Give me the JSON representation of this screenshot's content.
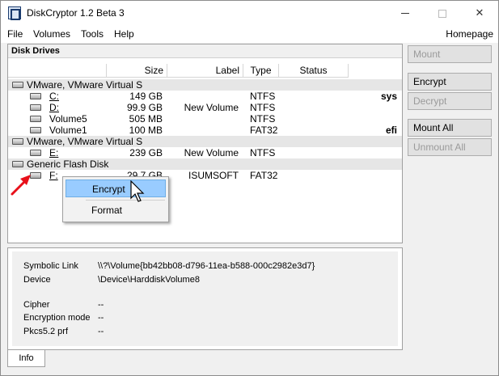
{
  "window": {
    "title": "DiskCryptor 1.2 Beta 3"
  },
  "menu": {
    "file": "File",
    "volumes": "Volumes",
    "tools": "Tools",
    "help": "Help",
    "homepage": "Homepage"
  },
  "drives": {
    "title": "Disk Drives",
    "columns": {
      "size": "Size",
      "label": "Label",
      "type": "Type",
      "status": "Status"
    },
    "groups": [
      {
        "name": "VMware, VMware Virtual S",
        "volumes": [
          {
            "name": "C:",
            "size": "149 GB",
            "label": "",
            "type": "NTFS",
            "flag": "sys"
          },
          {
            "name": "D:",
            "size": "99.9 GB",
            "label": "New Volume",
            "type": "NTFS",
            "flag": ""
          },
          {
            "name": "Volume5",
            "size": "505 MB",
            "label": "",
            "type": "NTFS",
            "flag": ""
          },
          {
            "name": "Volume1",
            "size": "100 MB",
            "label": "",
            "type": "FAT32",
            "flag": "efi"
          }
        ]
      },
      {
        "name": "VMware, VMware Virtual S",
        "volumes": [
          {
            "name": "E:",
            "size": "239 GB",
            "label": "New Volume",
            "type": "NTFS",
            "flag": ""
          }
        ]
      },
      {
        "name": "Generic Flash Disk",
        "volumes": [
          {
            "name": "F:",
            "size": "29.7 GB",
            "label": "ISUMSOFT",
            "type": "FAT32",
            "flag": ""
          }
        ]
      }
    ]
  },
  "context_menu": {
    "encrypt": "Encrypt",
    "format": "Format"
  },
  "info": {
    "tab": "Info",
    "symbolic_link_label": "Symbolic Link",
    "symbolic_link_value": "\\\\?\\Volume{bb42bb08-d796-11ea-b588-000c2982e3d7}",
    "device_label": "Device",
    "device_value": "\\Device\\HarddiskVolume8",
    "cipher_label": "Cipher",
    "cipher_value": "--",
    "encryption_mode_label": "Encryption mode",
    "encryption_mode_value": "--",
    "pkcs_label": "Pkcs5.2 prf",
    "pkcs_value": "--"
  },
  "buttons": {
    "mount": "Mount",
    "encrypt": "Encrypt",
    "decrypt": "Decrypt",
    "mount_all": "Mount All",
    "unmount_all": "Unmount All"
  }
}
